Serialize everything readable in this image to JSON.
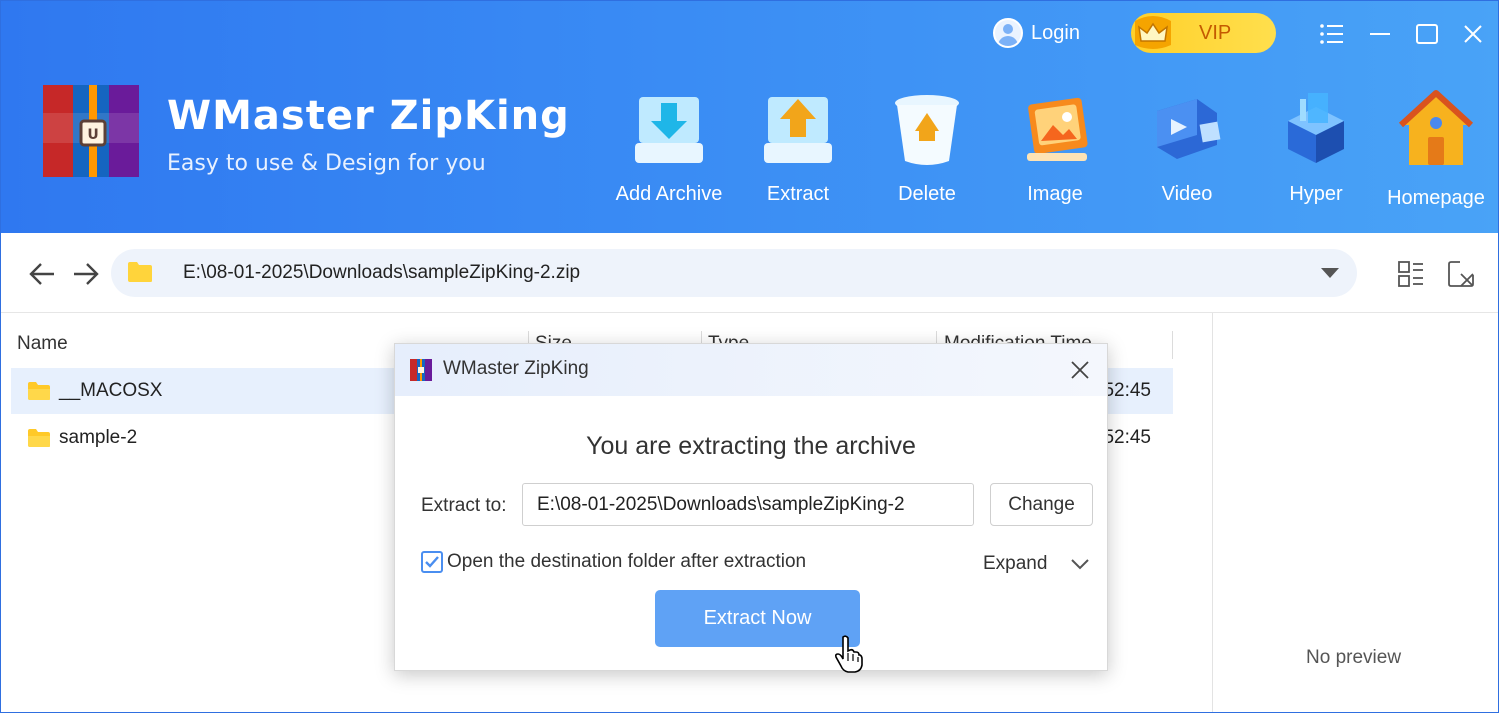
{
  "app": {
    "title": "WMaster ZipKing",
    "subtitle": "Easy to use & Design for you"
  },
  "topbar": {
    "login_label": "Login",
    "vip_label": "VIP",
    "icons": [
      "menu-icon",
      "minimize-icon",
      "maximize-icon",
      "close-icon"
    ]
  },
  "toolbar": {
    "items": [
      {
        "label": "Add Archive",
        "icon": "add-archive-icon"
      },
      {
        "label": "Extract",
        "icon": "extract-icon"
      },
      {
        "label": "Delete",
        "icon": "trash-icon"
      },
      {
        "label": "Image",
        "icon": "image-icon"
      },
      {
        "label": "Video",
        "icon": "video-icon"
      },
      {
        "label": "Hyper",
        "icon": "hyper-icon"
      },
      {
        "label": "Homepage",
        "icon": "home-icon"
      }
    ]
  },
  "addressbar": {
    "path": "E:\\08-01-2025\\Downloads\\sampleZipKing-2.zip"
  },
  "filelist": {
    "columns": {
      "name": "Name",
      "size": "Size",
      "type": "Type",
      "modified": "Modification Time"
    },
    "rows": [
      {
        "name": "__MACOSX",
        "time_suffix": "52:45",
        "selected": true
      },
      {
        "name": "sample-2",
        "time_suffix": "52:45",
        "selected": false
      }
    ]
  },
  "preview": {
    "empty_text": "No preview"
  },
  "dialog": {
    "title": "WMaster ZipKing",
    "heading": "You are extracting the archive",
    "extract_to_label": "Extract to:",
    "extract_to_value": "E:\\08-01-2025\\Downloads\\sampleZipKing-2",
    "change_label": "Change",
    "open_folder_label": "Open the destination folder after extraction",
    "open_folder_checked": true,
    "expand_label": "Expand",
    "extract_now_label": "Extract Now"
  },
  "colors": {
    "header_start": "#2f78f0",
    "header_end": "#49a3f7",
    "accent": "#5fa2f5",
    "vip": "#ffd02a",
    "selected_row": "#e7f0fd"
  }
}
